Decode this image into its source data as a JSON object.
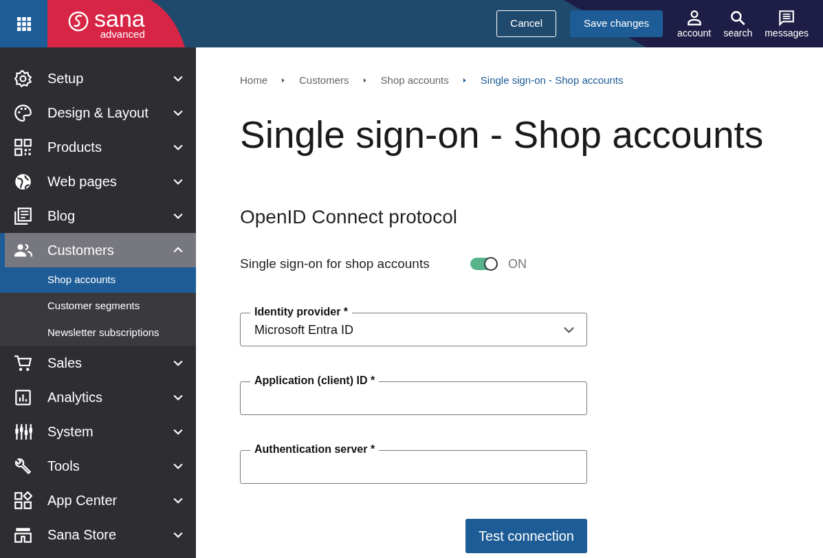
{
  "header": {
    "logo": {
      "name": "sana",
      "subtitle": "advanced"
    },
    "buttons": [
      {
        "label": "Cancel",
        "kind": "outline"
      },
      {
        "label": "Save changes",
        "kind": "primary"
      }
    ],
    "actions": [
      {
        "label": "account"
      },
      {
        "label": "search"
      },
      {
        "label": "messages"
      }
    ]
  },
  "sidebar": {
    "items": [
      {
        "label": "Setup",
        "expanded": false,
        "selected": false
      },
      {
        "label": "Design & Layout",
        "expanded": false,
        "selected": false
      },
      {
        "label": "Products",
        "expanded": false,
        "selected": false
      },
      {
        "label": "Web pages",
        "expanded": false,
        "selected": false
      },
      {
        "label": "Blog",
        "expanded": false,
        "selected": false
      },
      {
        "label": "Customers",
        "expanded": true,
        "selected": true,
        "children": [
          {
            "label": "Shop accounts",
            "selected": true
          },
          {
            "label": "Customer segments",
            "selected": false
          },
          {
            "label": "Newsletter subscriptions",
            "selected": false
          }
        ]
      },
      {
        "label": "Sales",
        "expanded": false,
        "selected": false
      },
      {
        "label": "Analytics",
        "expanded": false,
        "selected": false
      },
      {
        "label": "System",
        "expanded": false,
        "selected": false
      },
      {
        "label": "Tools",
        "expanded": false,
        "selected": false
      },
      {
        "label": "App Center",
        "expanded": false,
        "selected": false
      },
      {
        "label": "Sana Store",
        "expanded": false,
        "selected": false
      }
    ]
  },
  "breadcrumb": [
    "Home",
    "Customers",
    "Shop accounts",
    "Single sign-on - Shop accounts"
  ],
  "title": "Single sign-on - Shop accounts",
  "section": {
    "title": "OpenID Connect protocol",
    "toggle": {
      "label": "Single sign-on for shop accounts",
      "on": true,
      "state_label": "ON"
    },
    "fields": [
      {
        "kind": "select",
        "label": "Identity provider *",
        "value": "Microsoft Entra ID"
      },
      {
        "kind": "text",
        "label": "Application (client) ID *"
      },
      {
        "kind": "text",
        "label": "Authentication server *"
      }
    ],
    "button": "Test connection"
  }
}
